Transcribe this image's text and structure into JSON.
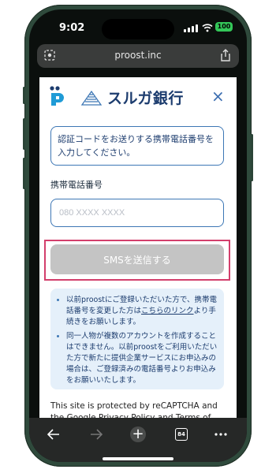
{
  "status_bar": {
    "time": "9:02",
    "battery": "100"
  },
  "browser": {
    "url": "proost.inc",
    "tab_count": "84"
  },
  "header": {
    "bank_name": "スルガ銀行",
    "close_symbol": "×"
  },
  "notice": {
    "text": "認証コードをお送りする携帯電話番号を入力してください。"
  },
  "form": {
    "phone_label": "携帯電話番号",
    "phone_placeholder": "080 XXXX XXXX",
    "sms_button_label": "SMSを送信する"
  },
  "info": {
    "item1_prefix": "以前proostにご登録いただいた方で、携帯電話番号を変更した方は",
    "item1_link": "こちらのリンク",
    "item1_suffix": "より手続きをお願いします。",
    "item2": "同一人物が複数のアカウントを作成することはできません。以前proostをご利用いただいた方で新たに提供企業サービスにお申込みの場合は、ご登録済みの電話番号よりお申込みをお願いいたします。"
  },
  "recaptcha_text": "This site is protected by reCAPTCHA and the Google Privacy Policy and Terms of Service",
  "colors": {
    "accent": "#3d77b5",
    "highlight": "#d33f6c",
    "disabled_button": "#c4c4c4",
    "info_bg": "#e5f0fa"
  }
}
